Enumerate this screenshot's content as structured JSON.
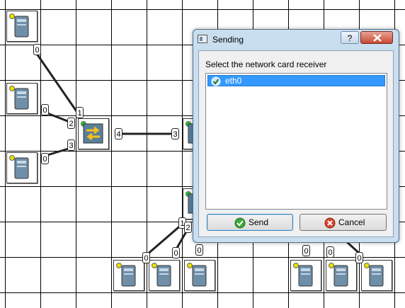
{
  "dialog": {
    "title": "Sending",
    "help_label": "?",
    "prompt": "Select the network card receiver",
    "cards": [
      {
        "label": "eth0",
        "selected": true
      }
    ],
    "send_label": "Send",
    "cancel_label": "Cancel"
  },
  "ports": {
    "pc_top_left": "0",
    "pc_mid_left": "0",
    "pc_low_left": "0",
    "switch_a_1": "1",
    "switch_a_2": "2",
    "switch_a_3": "3",
    "switch_a_4": "4",
    "switch_b_3": "3",
    "switch_c_1": "1",
    "switch_c_2": "2",
    "pc_bottom_1": "0",
    "pc_bottom_2": "0",
    "pc_bottom_3": "0",
    "pc_bottom_4": "0",
    "pc_bottom_5": "0",
    "pc_bottom_6": "0"
  },
  "colors": {
    "selection": "#3399ff",
    "led_idle": "#e8e000",
    "led_active": "#22cc22",
    "close_button": "#c64a32"
  },
  "icons": {
    "node_pc": "computer-tower-icon",
    "node_switch": "network-switch-icon",
    "send": "green-check-icon",
    "cancel": "red-x-icon"
  }
}
